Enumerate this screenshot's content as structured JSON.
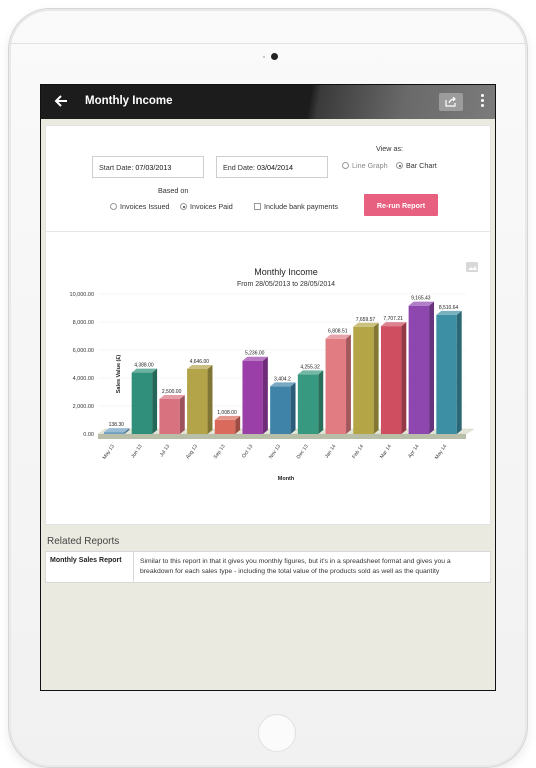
{
  "app": {
    "title": "Monthly Income"
  },
  "form": {
    "start_date_label": "Start Date:",
    "start_date_value": "07/03/2013",
    "end_date_label": "End Date:",
    "end_date_value": "03/04/2014",
    "view_as_label": "View as:",
    "view_options": [
      "Line Graph",
      "Bar Chart"
    ],
    "view_selected": "Bar Chart",
    "based_on_label": "Based on",
    "based_on_options": [
      "Invoices Issued",
      "Invoices Paid"
    ],
    "based_on_selected": "Invoices Paid",
    "include_bank_label": "Include bank payments",
    "include_bank_checked": false,
    "rerun_label": "Re-run Report"
  },
  "chart_data": {
    "type": "bar",
    "title": "Monthly Income",
    "subtitle": "From 28/05/2013 to 28/05/2014",
    "xlabel": "Month",
    "ylabel": "Sales Value (£)",
    "ylim": [
      0,
      10000
    ],
    "yticks": [
      "0.00",
      "2,000.00",
      "4,000.00",
      "6,000.00",
      "8,000.00",
      "10,000.00"
    ],
    "categories": [
      "May 13",
      "Jun 13",
      "Jul 13",
      "Aug 13",
      "Sep 13",
      "Oct 13",
      "Nov 13",
      "Dec 13",
      "Jan 14",
      "Feb 14",
      "Mar 14",
      "Apr 14",
      "May 14"
    ],
    "values": [
      138.3,
      4388.0,
      2500.0,
      4646.0,
      1008.0,
      5236.0,
      3404.2,
      4255.32,
      6808.51,
      7659.57,
      7707.21,
      9165.43,
      8510.64
    ],
    "data_labels": [
      "138.30",
      "4,388.00",
      "2,500.00",
      "4,646.00",
      "1,008.00",
      "5,236.00",
      "3,404.2",
      "4,255.32",
      "6,808.51",
      "7,659.57",
      "7,707.21",
      "9,165.43",
      "8,510.64"
    ],
    "colors": [
      "#6f9fc1",
      "#2f8f7a",
      "#d8727e",
      "#b3a349",
      "#d96a5c",
      "#9a3fa8",
      "#3f83a8",
      "#37997f",
      "#e07c82",
      "#b4a646",
      "#cf4e60",
      "#8f47b0",
      "#3d8fa3"
    ],
    "grid": true,
    "legend": "none"
  },
  "related": {
    "title": "Related Reports",
    "name": "Monthly Sales Report",
    "description": "Similar to this report in that it gives you monthly figures, but it's in a spreadsheet format and gives you a breakdown for each sales type - including the total value of the products sold as well as the quantity"
  }
}
